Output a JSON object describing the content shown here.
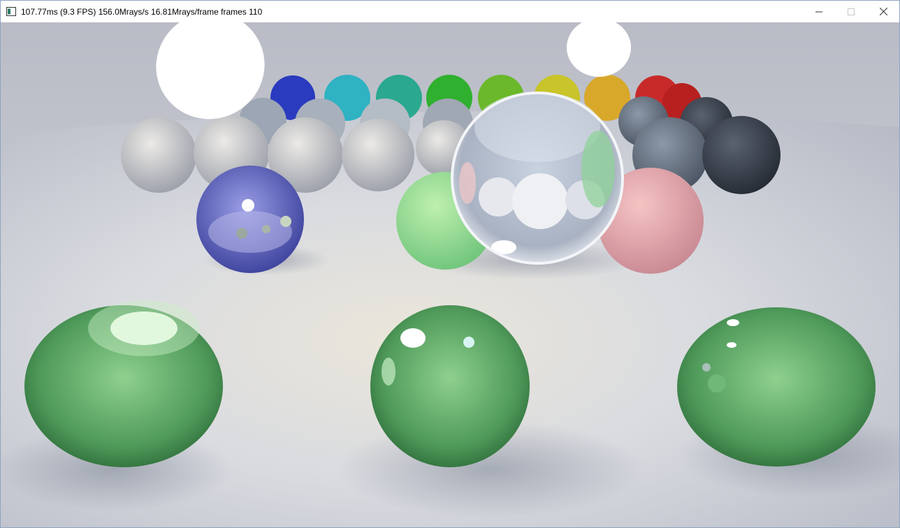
{
  "window": {
    "title": "107.77ms (9.3 FPS) 156.0Mrays/s 16.81Mrays/frame frames 110",
    "app_icon": "window-app-icon",
    "controls": {
      "minimize_icon": "minimize-icon",
      "maximize_icon": "maximize-icon",
      "close_icon": "close-icon"
    }
  },
  "render": {
    "floor_color": "#d8dbe3",
    "sky_color": "#c6c9d1",
    "back_row_colors": [
      "#2a3bbf",
      "#2fb2c2",
      "#2aa890",
      "#2fb02f",
      "#6bb82a",
      "#c8c42a",
      "#d8a82a",
      "#c82a2a"
    ],
    "front_spheres": [
      "green-glass",
      "green-glass",
      "green-glass"
    ],
    "mid_spheres": [
      "blue-glass",
      "green-diffuse",
      "clear-glass",
      "pink-diffuse"
    ]
  }
}
